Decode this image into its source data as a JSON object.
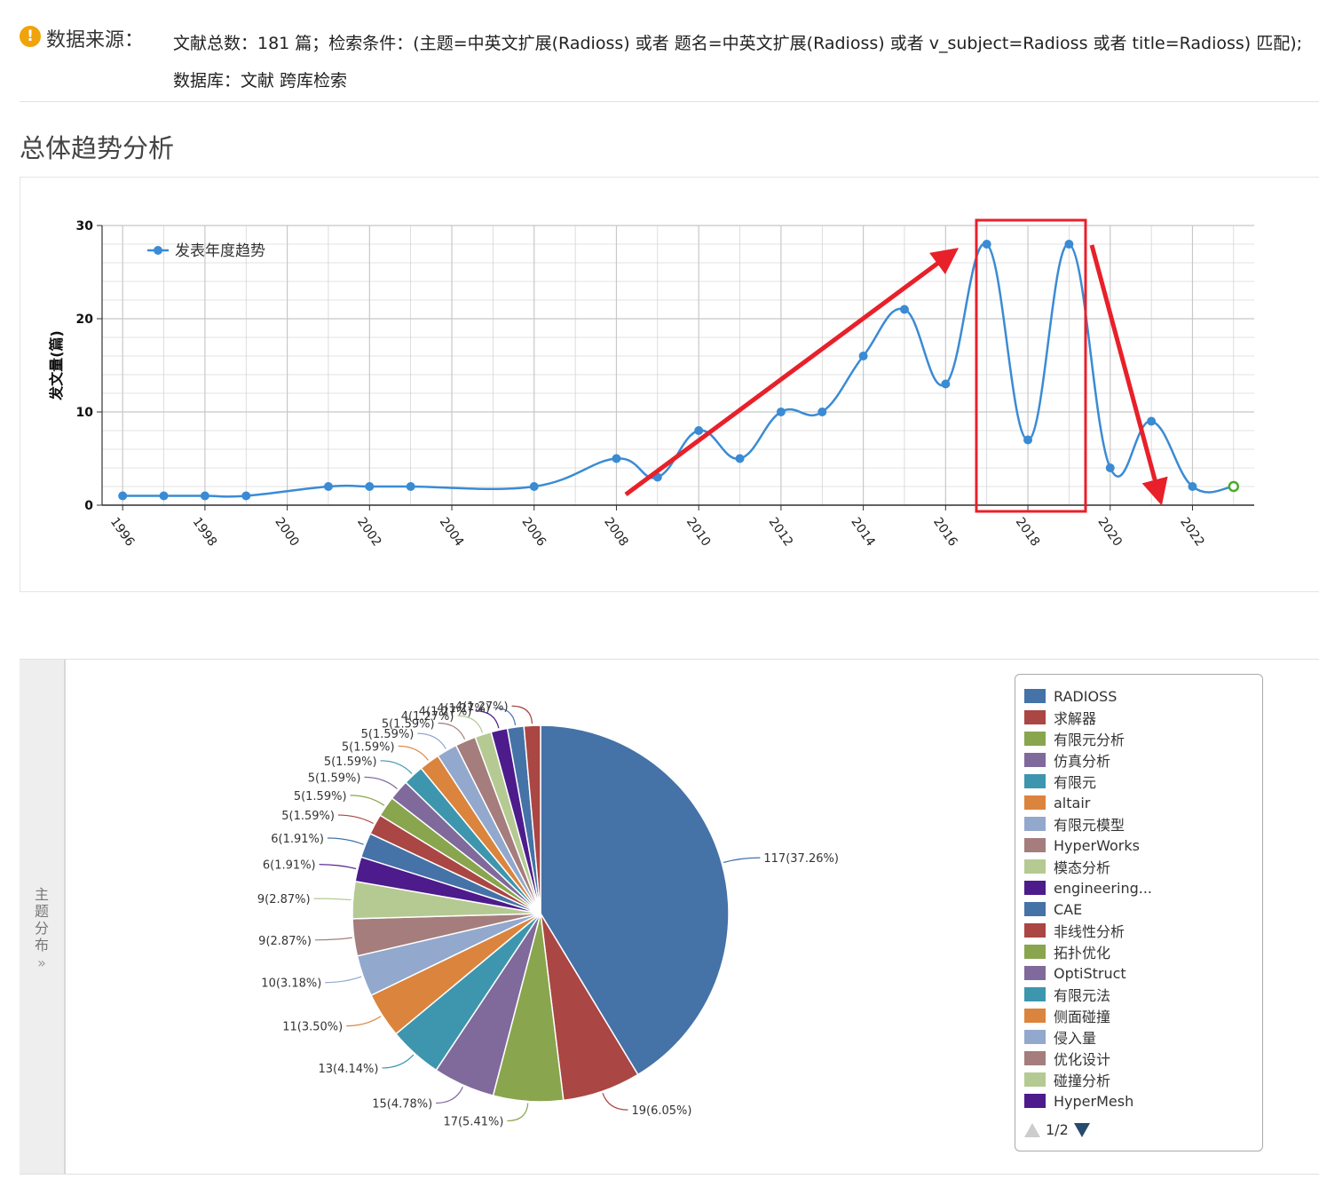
{
  "source": {
    "label": "数据来源：",
    "text": "文献总数：181 篇；检索条件：(主题=中英文扩展(Radioss) 或者 题名=中英文扩展(Radioss) 或者 v_subject=Radioss 或者 title=Radioss) 匹配); 数据库：文献 跨库检索"
  },
  "trend_section_title": "总体趋势分析",
  "colors": {
    "line": "#3a8bd4",
    "annotation": "#e8202a",
    "grid": "#c8c8c8",
    "pie": [
      "#4572a7",
      "#aa4643",
      "#89a54e",
      "#80699b",
      "#3d96ae",
      "#db843d",
      "#92a8cd",
      "#a47d7c",
      "#b5ca92",
      "#4d1b8c"
    ]
  },
  "chart_data": [
    {
      "type": "line",
      "legend": "发表年度趋势",
      "ylabel": "发文量(篇)",
      "ylim": [
        0,
        30
      ],
      "yticks": [
        0,
        10,
        20,
        30
      ],
      "xticks": [
        "1996",
        "1998",
        "2000",
        "2002",
        "2004",
        "2006",
        "2008",
        "2010",
        "2012",
        "2014",
        "2016",
        "2018",
        "2020",
        "2022"
      ],
      "x": [
        1996,
        1997,
        1998,
        1999,
        2001,
        2002,
        2003,
        2006,
        2008,
        2009,
        2010,
        2011,
        2012,
        2013,
        2014,
        2015,
        2016,
        2017,
        2018,
        2019,
        2020,
        2021,
        2022,
        2023
      ],
      "y": [
        1,
        1,
        1,
        1,
        2,
        2,
        2,
        2,
        5,
        3,
        8,
        5,
        10,
        10,
        16,
        21,
        13,
        28,
        7,
        28,
        4,
        9,
        2,
        2
      ],
      "legend_placement": "top-left",
      "grid": true
    },
    {
      "type": "pie",
      "legend_placement": "right",
      "slices": [
        {
          "name": "RADIOSS",
          "value": 117,
          "label": "117(37.26%)"
        },
        {
          "name": "求解器",
          "value": 19,
          "label": "19(6.05%)"
        },
        {
          "name": "有限元分析",
          "value": 17,
          "label": "17(5.41%)"
        },
        {
          "name": "仿真分析",
          "value": 15,
          "label": "15(4.78%)"
        },
        {
          "name": "有限元",
          "value": 13,
          "label": "13(4.14%)"
        },
        {
          "name": "altair",
          "value": 11,
          "label": "11(3.50%)"
        },
        {
          "name": "有限元模型",
          "value": 10,
          "label": "10(3.18%)"
        },
        {
          "name": "HyperWorks",
          "value": 9,
          "label": "9(2.87%)"
        },
        {
          "name": "模态分析",
          "value": 9,
          "label": "9(2.87%)"
        },
        {
          "name": "engineering...",
          "value": 6,
          "label": "6(1.91%)"
        },
        {
          "name": "CAE",
          "value": 6,
          "label": "6(1.91%)"
        },
        {
          "name": "非线性分析",
          "value": 5,
          "label": "5(1.59%)"
        },
        {
          "name": "拓扑优化",
          "value": 5,
          "label": "5(1.59%)"
        },
        {
          "name": "OptiStruct",
          "value": 5,
          "label": "5(1.59%)"
        },
        {
          "name": "有限元法",
          "value": 5,
          "label": "5(1.59%)"
        },
        {
          "name": "侧面碰撞",
          "value": 5,
          "label": "5(1.59%)"
        },
        {
          "name": "侵入量",
          "value": 5,
          "label": "5(1.59%)"
        },
        {
          "name": "优化设计",
          "value": 5,
          "label": "5(1.59%)"
        },
        {
          "name": "碰撞分析",
          "value": 4,
          "label": "4(1.27%)"
        },
        {
          "name": "HyperMesh",
          "value": 4,
          "label": "4(1.27%)"
        },
        {
          "name": "",
          "value": 4,
          "label": "4(1.27%)"
        },
        {
          "name": "",
          "value": 4,
          "label": "4(1.27%)"
        }
      ]
    }
  ],
  "pie_tab": {
    "title": "主题分布",
    "arrow": "»"
  },
  "legend_pager": {
    "text": "1/2"
  }
}
